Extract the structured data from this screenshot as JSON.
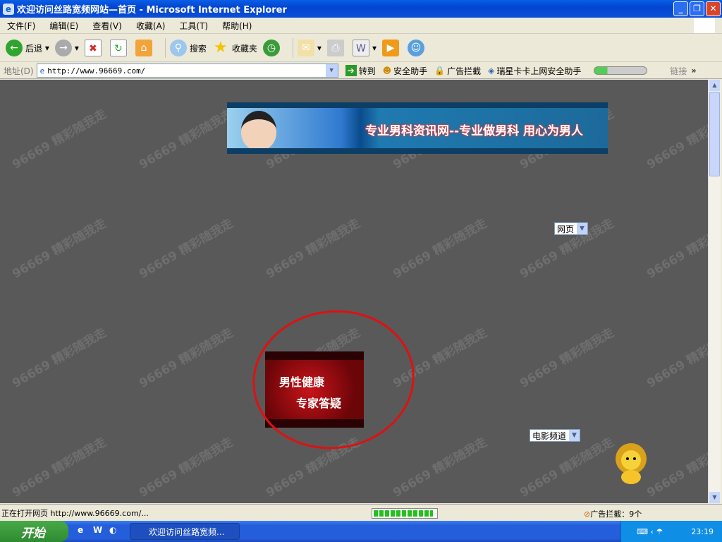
{
  "window": {
    "title": "欢迎访问丝路宽频网站—首页 - Microsoft Internet Explorer"
  },
  "menu": [
    "文件(F)",
    "编辑(E)",
    "查看(V)",
    "收藏(A)",
    "工具(T)",
    "帮助(H)"
  ],
  "toolbar": {
    "back": "后退",
    "search": "搜索",
    "favorites": "收藏夹"
  },
  "address": {
    "label": "地址(D)",
    "url": "http://www.96669.com/",
    "go": "转到",
    "links": "链接",
    "plugins": [
      "安全助手",
      "广告拦截",
      "瑞星卡卡上网安全助手"
    ]
  },
  "page": {
    "watermark": "96669 精彩随我走",
    "banner_text": "专业男科资讯网--专业做男科 用心为男人",
    "search_select": "网页",
    "ask_line1": "男性健康",
    "ask_line2": "专家答疑",
    "channel_select": "电影频道"
  },
  "status": {
    "text": "正在打开网页 http://www.96669.com/...",
    "progress": 0.95,
    "adblock": "广告拦截：9个"
  },
  "taskbar": {
    "start": "开始",
    "task": "欢迎访问丝路宽频...",
    "clock": "23:19"
  },
  "colors": {
    "content_bg": "#595959",
    "annotation": "#e01010",
    "titlebar": "#0a5fe6"
  }
}
